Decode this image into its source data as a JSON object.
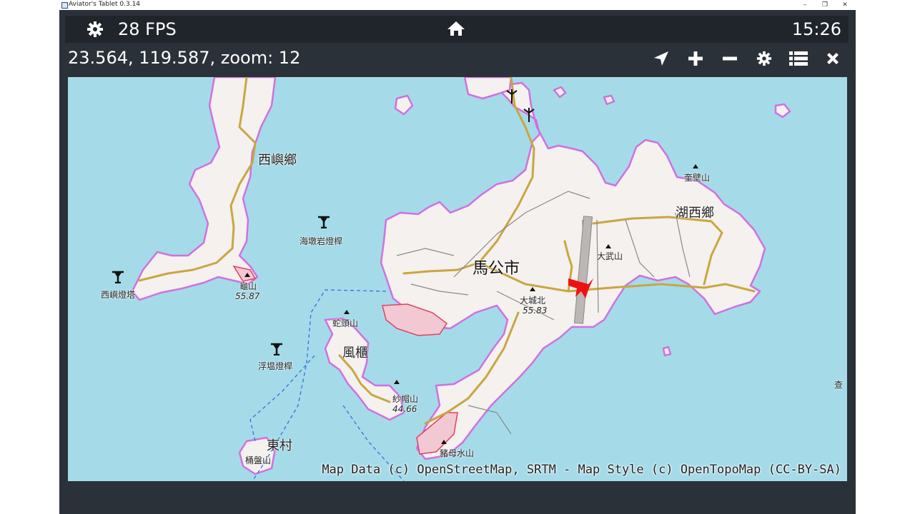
{
  "window": {
    "title": "Aviator's Tablet  0.3.14",
    "controls": [
      "–",
      "❐",
      "✕"
    ]
  },
  "topbar": {
    "fps": "28 FPS",
    "clock": "15:26",
    "icons": [
      "gear-icon",
      "home-icon"
    ]
  },
  "position": {
    "text": "23.564, 119.587, zoom: 12"
  },
  "toolbar": {
    "items": [
      "locate-icon",
      "zoom-in-icon",
      "zoom-out-icon",
      "settings-icon",
      "list-icon",
      "close-icon"
    ]
  },
  "map": {
    "labels": {
      "xiyu": "西嶼鄉",
      "haidun": "海墩岩燈桿",
      "magong": "馬公市",
      "huxi": "湖西鄉",
      "kuibi": "奎壁山",
      "dawu": "大武山",
      "dachengbei": "大城北",
      "dachengbei_elev": "55.83",
      "gui": "龜山",
      "gui_elev": "55.87",
      "xiyu_lighthouse": "西嶼燈塔",
      "shetou": "蛇頭山",
      "fenggui": "風櫃",
      "futou": "浮塭燈桿",
      "shamao": "紗帽山",
      "shamao_elev": "44.66",
      "dongcun": "東村",
      "tongpan": "桶盤山",
      "zhumu": "豬母水山",
      "edge": "查"
    },
    "attribution": "Map Data (c) OpenStreetMap, SRTM - Map Style (c) OpenTopoMap (CC-BY-SA)",
    "colors": {
      "water": "#a5dbe8",
      "land": "#f4f1ee",
      "coast": "#d070e0",
      "road": "#c9a640"
    }
  }
}
